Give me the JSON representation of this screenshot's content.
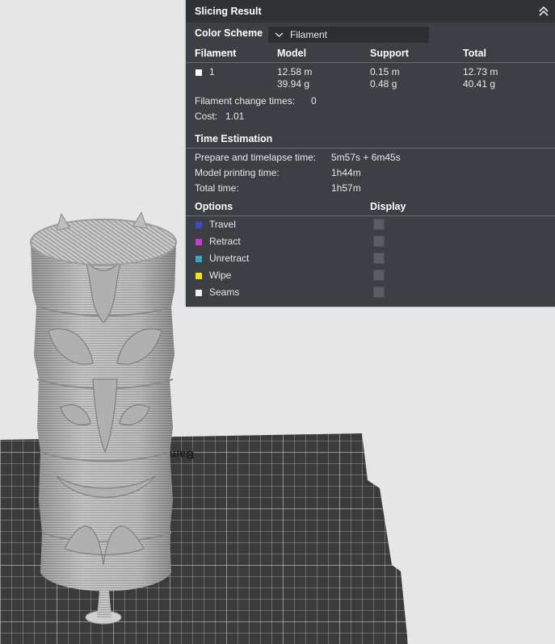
{
  "panel": {
    "title": "Slicing Result",
    "color_scheme_label": "Color Scheme",
    "color_scheme_value": "Filament",
    "table_headers": [
      "Filament",
      "Model",
      "Support",
      "Total"
    ],
    "filament_row": {
      "id": "1",
      "model_length": "12.58 m",
      "model_weight": "39.94 g",
      "support_length": "0.15 m",
      "support_weight": "0.48 g",
      "total_length": "12.73 m",
      "total_weight": "40.41 g"
    },
    "filament_change_label": "Filament change times:",
    "filament_change_value": "0",
    "cost_label": "Cost:",
    "cost_value": "1.01",
    "time_estimation_title": "Time Estimation",
    "prepare_label": "Prepare and timelapse time:",
    "prepare_value": "5m57s + 6m45s",
    "model_time_label": "Model printing time:",
    "model_time_value": "1h44m",
    "total_time_label": "Total time:",
    "total_time_value": "1h57m",
    "options_title": "Options",
    "display_title": "Display",
    "options": [
      {
        "label": "Travel",
        "color": "#3a4bd1"
      },
      {
        "label": "Retract",
        "color": "#c43ad0"
      },
      {
        "label": "Unretract",
        "color": "#35a6c9"
      },
      {
        "label": "Wipe",
        "color": "#f2e41a"
      },
      {
        "label": "Seams",
        "color": "#eeeeee"
      }
    ]
  },
  "plate": {
    "label": "Bambu Textured P"
  }
}
